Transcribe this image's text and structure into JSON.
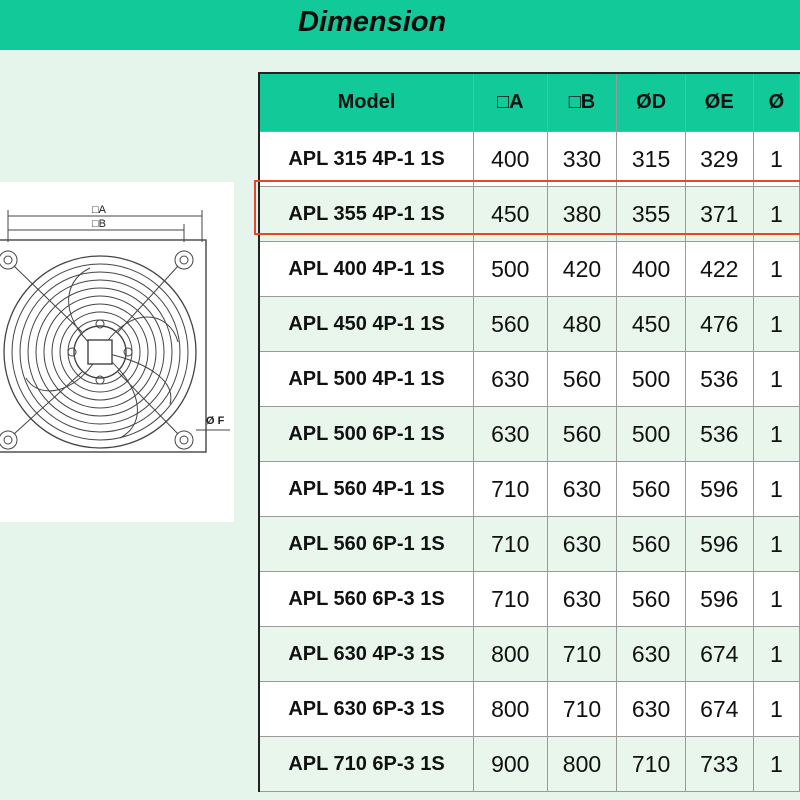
{
  "header": {
    "title": "Dimension"
  },
  "drawing": {
    "label_a": "□A",
    "label_b": "□B",
    "label_f": "Ø F"
  },
  "table": {
    "columns": [
      "Model",
      "□A",
      "□B",
      "ØD",
      "ØE",
      "Ø"
    ],
    "rows": [
      {
        "model": "APL 315 4P-1 1S",
        "a": "400",
        "b": "330",
        "d": "315",
        "e": "329",
        "f": "1"
      },
      {
        "model": "APL 355 4P-1 1S",
        "a": "450",
        "b": "380",
        "d": "355",
        "e": "371",
        "f": "1"
      },
      {
        "model": "APL 400 4P-1 1S",
        "a": "500",
        "b": "420",
        "d": "400",
        "e": "422",
        "f": "1"
      },
      {
        "model": "APL 450 4P-1 1S",
        "a": "560",
        "b": "480",
        "d": "450",
        "e": "476",
        "f": "1"
      },
      {
        "model": "APL 500 4P-1 1S",
        "a": "630",
        "b": "560",
        "d": "500",
        "e": "536",
        "f": "1"
      },
      {
        "model": "APL 500 6P-1 1S",
        "a": "630",
        "b": "560",
        "d": "500",
        "e": "536",
        "f": "1"
      },
      {
        "model": "APL 560 4P-1 1S",
        "a": "710",
        "b": "630",
        "d": "560",
        "e": "596",
        "f": "1"
      },
      {
        "model": "APL 560 6P-1 1S",
        "a": "710",
        "b": "630",
        "d": "560",
        "e": "596",
        "f": "1"
      },
      {
        "model": "APL 560 6P-3 1S",
        "a": "710",
        "b": "630",
        "d": "560",
        "e": "596",
        "f": "1"
      },
      {
        "model": "APL 630 4P-3 1S",
        "a": "800",
        "b": "710",
        "d": "630",
        "e": "674",
        "f": "1"
      },
      {
        "model": "APL 630 6P-3 1S",
        "a": "800",
        "b": "710",
        "d": "630",
        "e": "674",
        "f": "1"
      },
      {
        "model": "APL 710 6P-3 1S",
        "a": "900",
        "b": "800",
        "d": "710",
        "e": "733",
        "f": "1"
      }
    ],
    "highlighted_row": 1,
    "highlight_color": "#e8462a"
  },
  "colors": {
    "accent": "#12c99a",
    "background": "#e6f5ec",
    "alt_row": "#e8f6ec"
  }
}
